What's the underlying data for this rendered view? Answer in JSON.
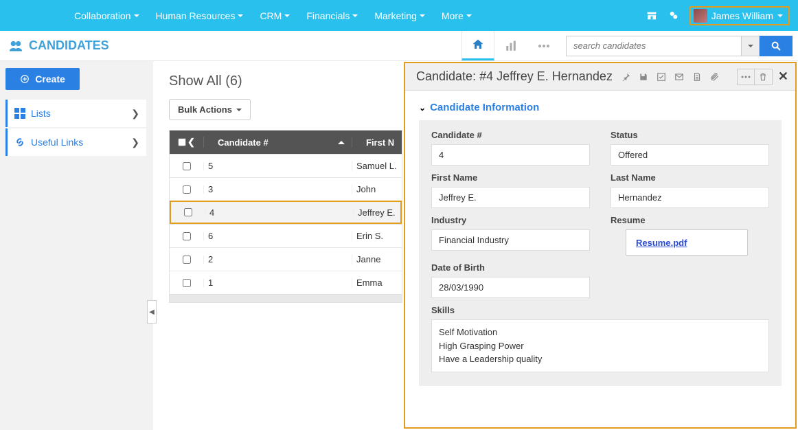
{
  "topnav": {
    "menus": [
      "Collaboration",
      "Human Resources",
      "CRM",
      "Financials",
      "Marketing",
      "More"
    ],
    "user": "James William"
  },
  "subheader": {
    "brand": "CANDIDATES",
    "search_placeholder": "search candidates"
  },
  "sidebar": {
    "create_label": "Create",
    "items": [
      {
        "label": "Lists",
        "icon": "grid-icon"
      },
      {
        "label": "Useful Links",
        "icon": "link-icon"
      }
    ]
  },
  "main": {
    "heading": "Show All (6)",
    "bulk_label": "Bulk Actions",
    "columns": {
      "num": "Candidate #",
      "first": "First N"
    },
    "rows": [
      {
        "num": "5",
        "first": "Samuel L.",
        "selected": false
      },
      {
        "num": "3",
        "first": "John",
        "selected": false
      },
      {
        "num": "4",
        "first": "Jeffrey E.",
        "selected": true
      },
      {
        "num": "6",
        "first": "Erin S.",
        "selected": false
      },
      {
        "num": "2",
        "first": "Janne",
        "selected": false
      },
      {
        "num": "1",
        "first": "Emma",
        "selected": false
      }
    ]
  },
  "detail": {
    "title": "Candidate: #4 Jeffrey E. Hernandez",
    "section": "Candidate Information",
    "fields": {
      "candidate_num": {
        "label": "Candidate #",
        "value": "4"
      },
      "status": {
        "label": "Status",
        "value": "Offered"
      },
      "first_name": {
        "label": "First Name",
        "value": "Jeffrey E."
      },
      "last_name": {
        "label": "Last Name",
        "value": "Hernandez"
      },
      "industry": {
        "label": "Industry",
        "value": "Financial Industry"
      },
      "resume": {
        "label": "Resume",
        "link": "Resume.pdf"
      },
      "dob": {
        "label": "Date of Birth",
        "value": "28/03/1990"
      },
      "skills": {
        "label": "Skills",
        "values": [
          "Self Motivation",
          "High Grasping Power",
          "Have a Leadership quality"
        ]
      }
    }
  }
}
